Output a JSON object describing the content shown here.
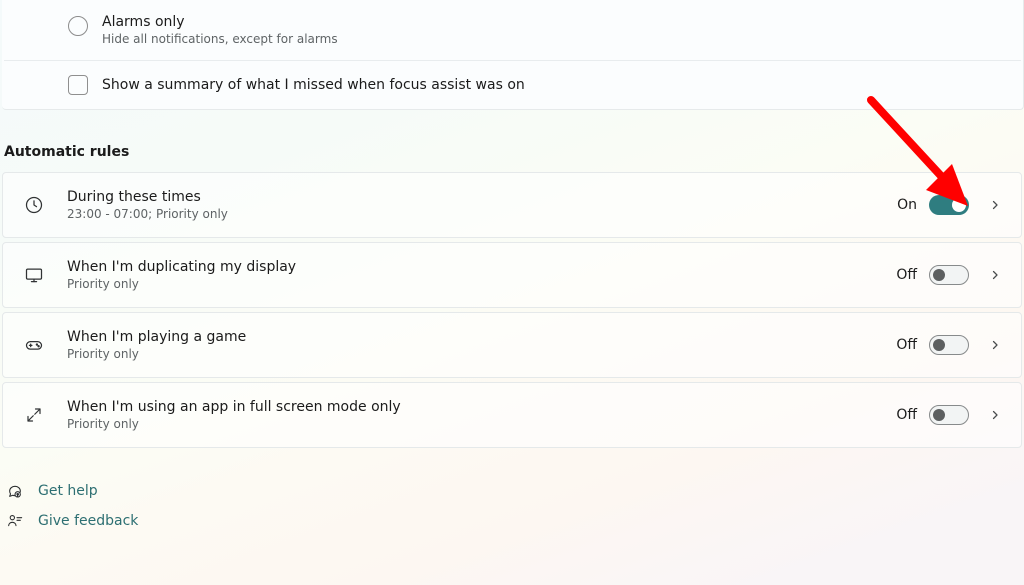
{
  "top": {
    "alarms_title": "Alarms only",
    "alarms_sub": "Hide all notifications, except for alarms",
    "summary_label": "Show a summary of what I missed when focus assist was on"
  },
  "section_title": "Automatic rules",
  "rules": [
    {
      "title": "During these times",
      "sub": "23:00 - 07:00; Priority only",
      "state_label": "On",
      "on": true
    },
    {
      "title": "When I'm duplicating my display",
      "sub": "Priority only",
      "state_label": "Off",
      "on": false
    },
    {
      "title": "When I'm playing a game",
      "sub": "Priority only",
      "state_label": "Off",
      "on": false
    },
    {
      "title": "When I'm using an app in full screen mode only",
      "sub": "Priority only",
      "state_label": "Off",
      "on": false
    }
  ],
  "links": {
    "help": "Get help",
    "feedback": "Give feedback"
  }
}
